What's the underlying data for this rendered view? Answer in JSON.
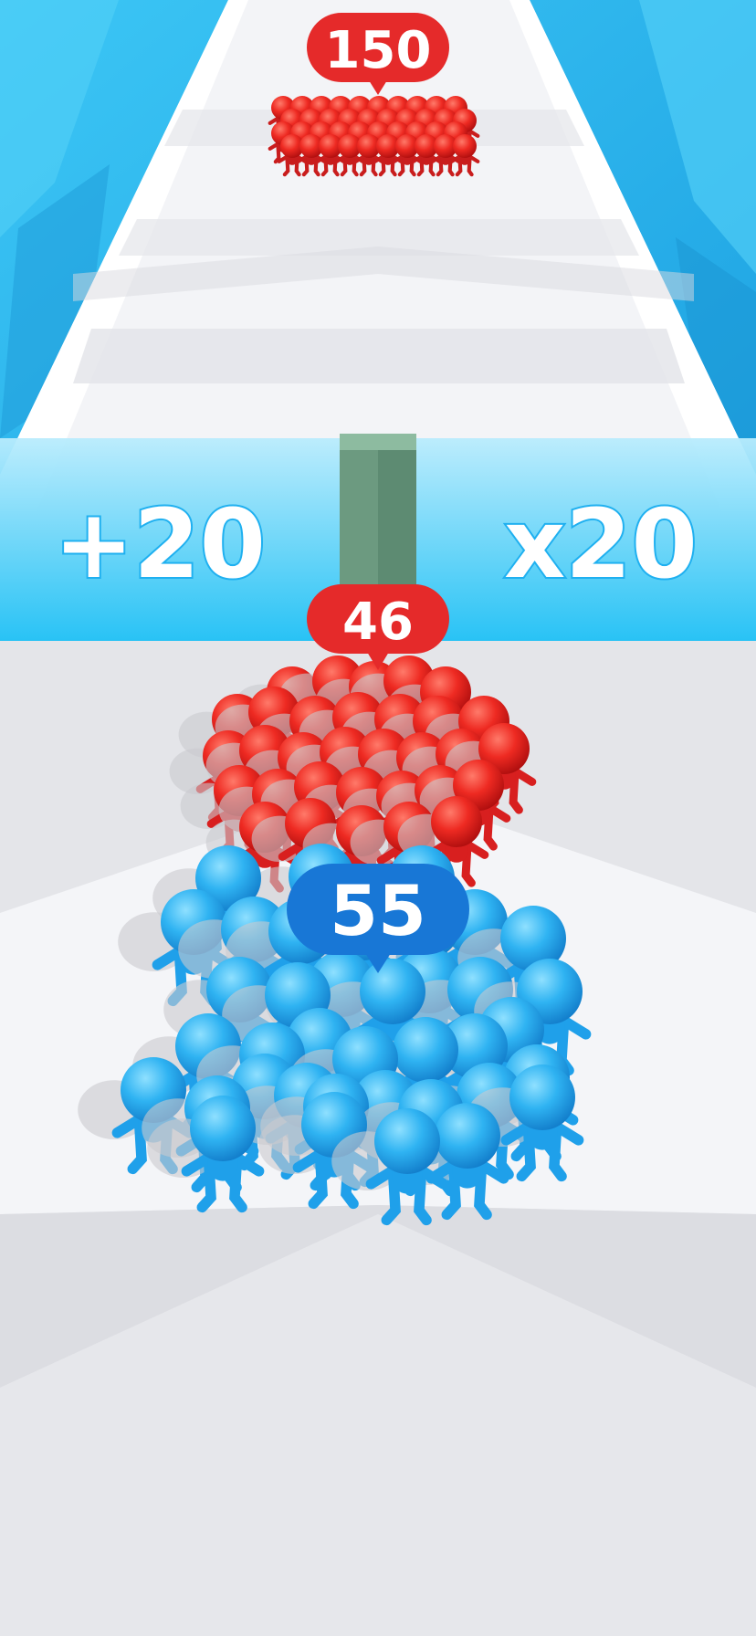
{
  "hud": {
    "enemy_far_count": "150",
    "enemy_near_count": "46",
    "player_count": "55"
  },
  "gates": {
    "left_label": "+20",
    "right_label": "x20"
  },
  "colors": {
    "player": "#2aa9ee",
    "enemy": "#e52a2a",
    "gate": "#26c4f5",
    "track": "#f2f3f5",
    "ice": "#2fb6ea"
  }
}
